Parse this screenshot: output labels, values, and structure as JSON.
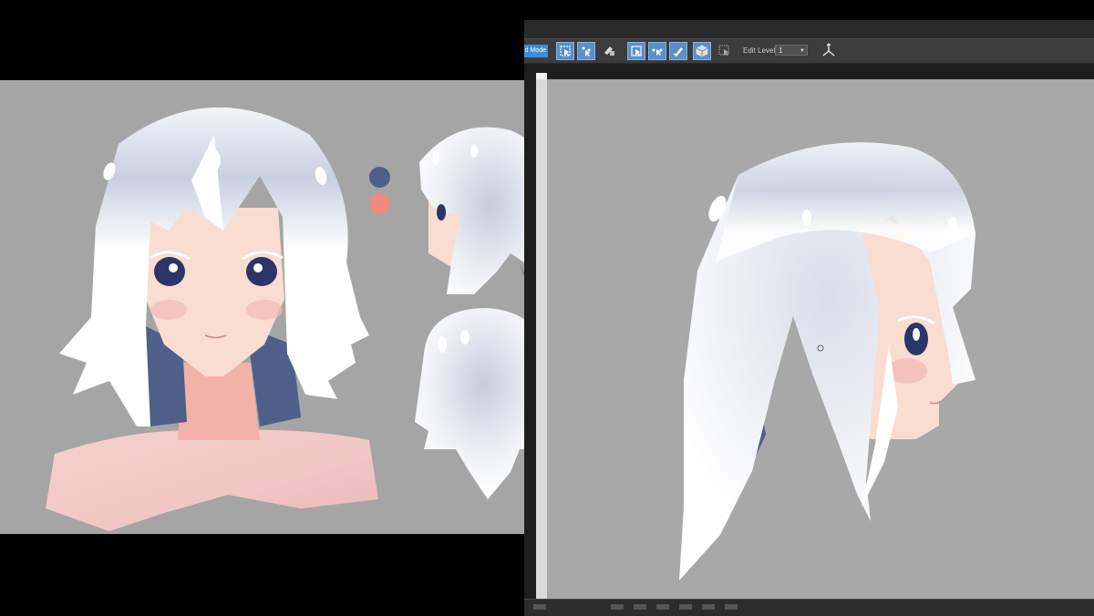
{
  "toolbar": {
    "mode_button_label": "d Mode",
    "edit_level_label": "Edit Level:",
    "edit_level_value": "1"
  },
  "colors": {
    "swatch_blue": "#4e5f8a",
    "swatch_pink": "#ef8a7f",
    "hair_white": "#ffffff",
    "hair_shadow": "#c9cfdd",
    "skin": "#f7dccc",
    "viewport_bg": "#a8a8a8"
  },
  "icons": [
    "select-object-icon",
    "select-vertex-icon",
    "lock-selection-icon",
    "select-face-icon",
    "move-vertex-icon",
    "paint-brush-icon",
    "cube-view-icon",
    "wireframe-icon",
    "transform-gizmo-icon"
  ]
}
